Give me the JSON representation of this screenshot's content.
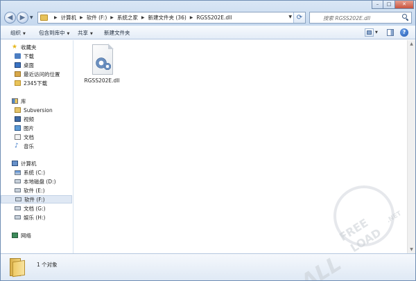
{
  "address_bar": {
    "breadcrumbs": [
      "计算机",
      "软件 (F:)",
      "系统之家",
      "新建文件夹 (36)",
      "RGSS202E.dll"
    ]
  },
  "search": {
    "placeholder": "搜索 RGSS202E.dll"
  },
  "window_controls": {
    "minimize": "–",
    "maximize": "□",
    "close": "✕"
  },
  "toolbar": {
    "organize": "组织",
    "include_in_library": "包含到库中",
    "share": "共享",
    "new_folder": "新建文件夹",
    "help": "?"
  },
  "sidebar": {
    "favorites": {
      "header": "收藏夹",
      "items": [
        "下载",
        "桌面",
        "最近访问的位置",
        "2345下载"
      ]
    },
    "libraries": {
      "header": "库",
      "items": [
        "Subversion",
        "视频",
        "图片",
        "文档",
        "音乐"
      ]
    },
    "computer": {
      "header": "计算机",
      "items": [
        "系统 (C:)",
        "本地磁盘 (D:)",
        "软件 (E:)",
        "软件 (F:)",
        "文档 (G:)",
        "娱乐 (H:)"
      ],
      "selected": "软件 (F:)"
    },
    "network": {
      "header": "网络"
    }
  },
  "content": {
    "files": [
      {
        "name": "RGSS202E.dll",
        "icon": "dll-gear-file-icon"
      }
    ]
  },
  "details_pane": {
    "text": "1 个对象"
  },
  "watermark": {
    "line1": "ALL",
    "line2": "FREE",
    "line3": "LOAD",
    "line4": ".NET"
  },
  "colors": {
    "titlebar": "#c5d8ee",
    "selection": "#dfe8f4",
    "close_button": "#c9533e"
  }
}
